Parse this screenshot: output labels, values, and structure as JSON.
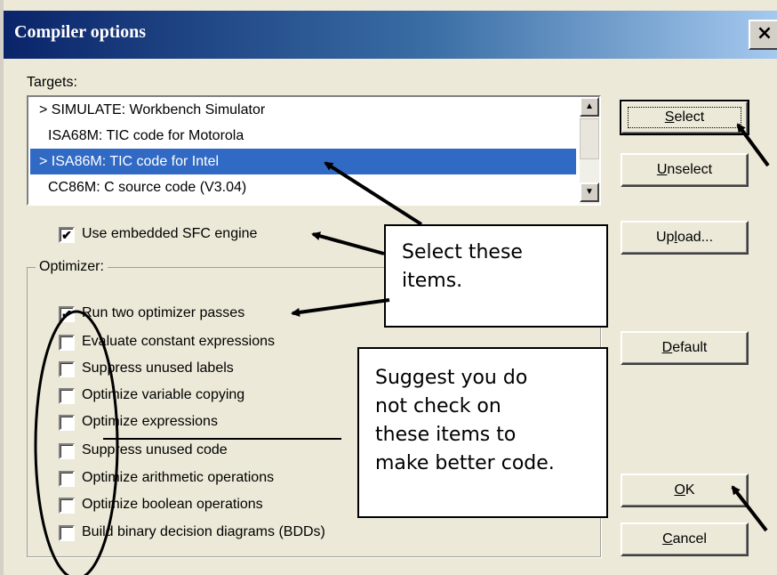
{
  "window": {
    "title": "Compiler options",
    "close_glyph": "×"
  },
  "targets": {
    "label": "Targets:",
    "items": [
      {
        "marker": ">",
        "text": "SIMULATE: Workbench Simulator",
        "selected": false
      },
      {
        "marker": "",
        "text": "ISA68M: TIC code for Motorola",
        "selected": false
      },
      {
        "marker": ">",
        "text": "ISA86M: TIC code for Intel",
        "selected": true
      },
      {
        "marker": "",
        "text": "CC86M: C source code (V3.04)",
        "selected": false
      }
    ],
    "scroll_up_glyph": "▲",
    "scroll_down_glyph": "▼"
  },
  "sfc_engine": {
    "label": "Use embedded SFC engine",
    "checked": true
  },
  "optimizer": {
    "label": "Optimizer:",
    "options": [
      {
        "label": "Run two optimizer passes",
        "checked": true
      },
      {
        "label": "Evaluate constant expressions",
        "checked": false
      },
      {
        "label": "Suppress unused labels",
        "checked": false
      },
      {
        "label": "Optimize variable copying",
        "checked": false
      },
      {
        "label": "Optimize expressions",
        "checked": false
      },
      {
        "label": "Suppress unused code",
        "checked": false
      },
      {
        "label": "Optimize arithmetic operations",
        "checked": false
      },
      {
        "label": "Optimize boolean operations",
        "checked": false
      },
      {
        "label": "Build binary decision diagrams (BDDs)",
        "checked": false
      }
    ]
  },
  "buttons": {
    "select": {
      "mnemonic": "S",
      "rest": "elect"
    },
    "unselect": {
      "mnemonic": "U",
      "rest": "nselect"
    },
    "upload": {
      "pre": "Up",
      "mnemonic": "l",
      "rest": "oad..."
    },
    "default": {
      "mnemonic": "D",
      "rest": "efault"
    },
    "ok": {
      "mnemonic": "O",
      "rest": "K"
    },
    "cancel": {
      "mnemonic": "C",
      "rest": "ancel"
    }
  },
  "callouts": {
    "select": [
      "Select these",
      "items."
    ],
    "suggest": [
      "Suggest you do",
      "not check on",
      "these items to",
      "make better code."
    ]
  },
  "check_glyph": "✔",
  "colors": {
    "title_gradient_start": "#0a246a",
    "selection": "#316ac5",
    "dialog_bg": "#ece9d8"
  }
}
